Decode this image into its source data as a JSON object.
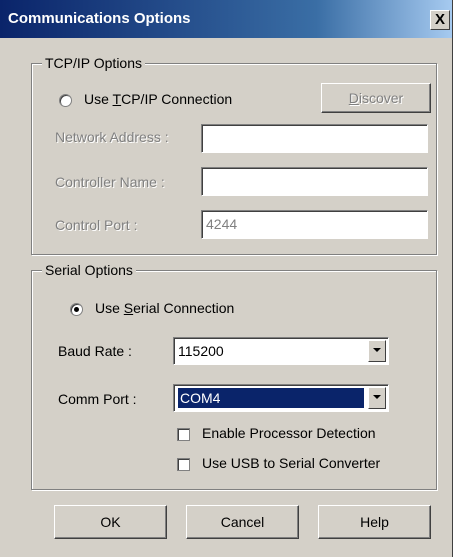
{
  "window": {
    "title": "Communications Options",
    "close_glyph": "X"
  },
  "tcpip": {
    "group_label": "TCP/IP Options",
    "use_connection_prefix": "Use ",
    "use_connection_mnemonic": "T",
    "use_connection_suffix": "CP/IP Connection",
    "use_connection_selected": false,
    "discover_mnemonic": "D",
    "discover_suffix": "iscover",
    "network_address_label": "Network Address :",
    "network_address_value": "",
    "controller_name_label": "Controller Name :",
    "controller_name_value": "",
    "control_port_label": "Control Port :",
    "control_port_value": "4244"
  },
  "serial": {
    "group_label": "Serial Options",
    "use_connection_prefix": "Use ",
    "use_connection_mnemonic": "S",
    "use_connection_suffix": "erial Connection",
    "use_connection_selected": true,
    "baud_rate_label": "Baud Rate :",
    "baud_rate_value": "115200",
    "comm_port_label": "Comm Port :",
    "comm_port_value": "COM4",
    "enable_processor_detection_label": "Enable Processor Detection",
    "enable_processor_detection_checked": false,
    "use_usb_label": "Use USB to Serial Converter",
    "use_usb_checked": false
  },
  "buttons": {
    "ok": "OK",
    "cancel": "Cancel",
    "help": "Help"
  }
}
